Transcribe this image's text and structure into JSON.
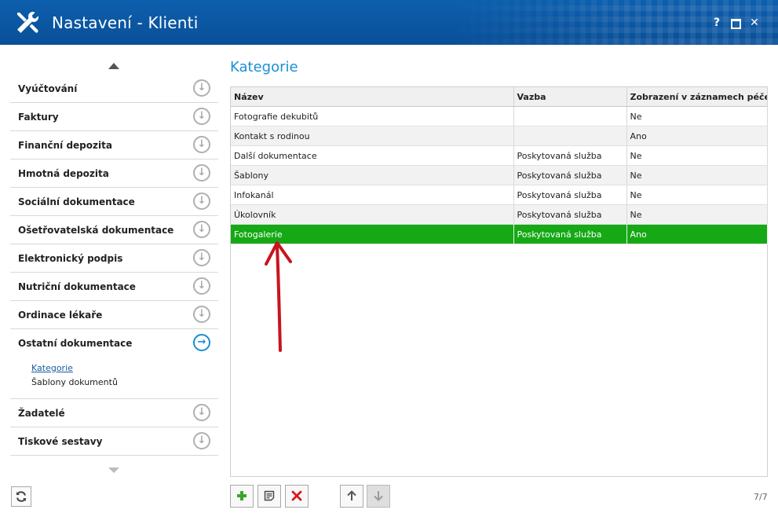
{
  "window": {
    "title": "Nastavení - Klienti",
    "help_label": "?",
    "close_label": "✕"
  },
  "sidebar": {
    "items": [
      {
        "label": "Vyúčtování"
      },
      {
        "label": "Faktury"
      },
      {
        "label": "Finanční depozita"
      },
      {
        "label": "Hmotná depozita"
      },
      {
        "label": "Sociální dokumentace"
      },
      {
        "label": "Ošetřovatelská dokumentace"
      },
      {
        "label": "Elektronický podpis"
      },
      {
        "label": "Nutriční dokumentace"
      },
      {
        "label": "Ordinace lékaře"
      },
      {
        "label": "Ostatní dokumentace"
      },
      {
        "label": "Žadatelé"
      },
      {
        "label": "Tiskové sestavy"
      }
    ],
    "subitems": [
      {
        "label": "Kategorie"
      },
      {
        "label": "Šablony dokumentů"
      }
    ]
  },
  "main": {
    "title": "Kategorie",
    "columns": [
      "Název",
      "Vazba",
      "Zobrazení v záznamech péče"
    ],
    "rows": [
      [
        "Fotografie dekubitů",
        "",
        "Ne"
      ],
      [
        "Kontakt s rodinou",
        "",
        "Ano"
      ],
      [
        "Další dokumentace",
        "Poskytovaná služba",
        "Ne"
      ],
      [
        "Šablony",
        "Poskytovaná služba",
        "Ne"
      ],
      [
        "Infokanál",
        "Poskytovaná služba",
        "Ne"
      ],
      [
        "Úkolovník",
        "Poskytovaná služba",
        "Ne"
      ],
      [
        "Fotogalerie",
        "Poskytovaná služba",
        "Ano"
      ]
    ],
    "record_counter": "7/7"
  },
  "colors": {
    "titlebar": "#0a4f98",
    "accent": "#1a8fd6",
    "selected_row": "#15a915",
    "annotation_arrow": "#c8141e"
  },
  "icons": {
    "app": "wrench-screwdriver-icon",
    "refresh": "refresh-icon",
    "add": "plus-icon",
    "edit": "document-icon",
    "delete": "x-icon",
    "up": "arrow-up-icon",
    "down": "arrow-down-icon"
  }
}
